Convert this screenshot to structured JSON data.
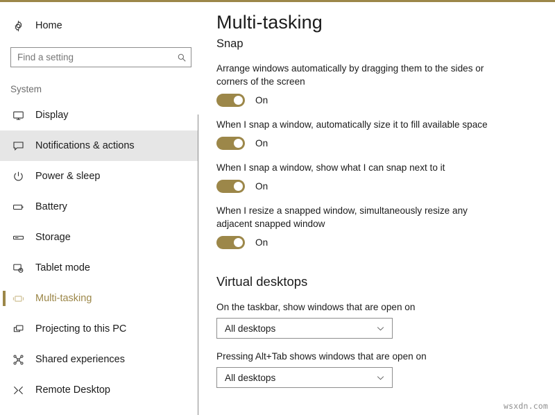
{
  "theme": {
    "accent": "#9c8749",
    "accent_light": "#c9b887",
    "highlight_row": "#e6e6e6",
    "text": "#1b1b1b",
    "muted_text": "#6d6d6d",
    "border": "#8d8d8d"
  },
  "sidebar": {
    "home": {
      "label": "Home",
      "icon": "gear-icon"
    },
    "search": {
      "value": "",
      "placeholder": "Find a setting",
      "icon": "search-icon"
    },
    "group_title": "System",
    "items": [
      {
        "label": "Display",
        "icon": "monitor-icon",
        "state": "normal"
      },
      {
        "label": "Notifications & actions",
        "icon": "notification-bubble-icon",
        "state": "hovered"
      },
      {
        "label": "Power & sleep",
        "icon": "power-icon",
        "state": "normal"
      },
      {
        "label": "Battery",
        "icon": "battery-icon",
        "state": "normal"
      },
      {
        "label": "Storage",
        "icon": "storage-icon",
        "state": "normal"
      },
      {
        "label": "Tablet mode",
        "icon": "tablet-icon",
        "state": "normal"
      },
      {
        "label": "Multi-tasking",
        "icon": "multitasking-icon",
        "state": "selected"
      },
      {
        "label": "Projecting to this PC",
        "icon": "projecting-icon",
        "state": "normal"
      },
      {
        "label": "Shared experiences",
        "icon": "shared-icon",
        "state": "normal"
      },
      {
        "label": "Remote Desktop",
        "icon": "remote-desktop-icon",
        "state": "normal"
      }
    ]
  },
  "main": {
    "page_title": "Multi-tasking",
    "snap": {
      "heading": "Snap",
      "settings": [
        {
          "description": "Arrange windows automatically by dragging them to the sides or corners of the screen",
          "toggle_state": "On"
        },
        {
          "description": "When I snap a window, automatically size it to fill available space",
          "toggle_state": "On"
        },
        {
          "description": "When I snap a window, show what I can snap next to it",
          "toggle_state": "On"
        },
        {
          "description": "When I resize a snapped window, simultaneously resize any adjacent snapped window",
          "toggle_state": "On"
        }
      ]
    },
    "virtual_desktops": {
      "heading": "Virtual desktops",
      "fields": [
        {
          "label": "On the taskbar, show windows that are open on",
          "selected": "All desktops"
        },
        {
          "label": "Pressing Alt+Tab shows windows that are open on",
          "selected": "All desktops"
        }
      ]
    }
  },
  "watermark": "wsxdn.com"
}
